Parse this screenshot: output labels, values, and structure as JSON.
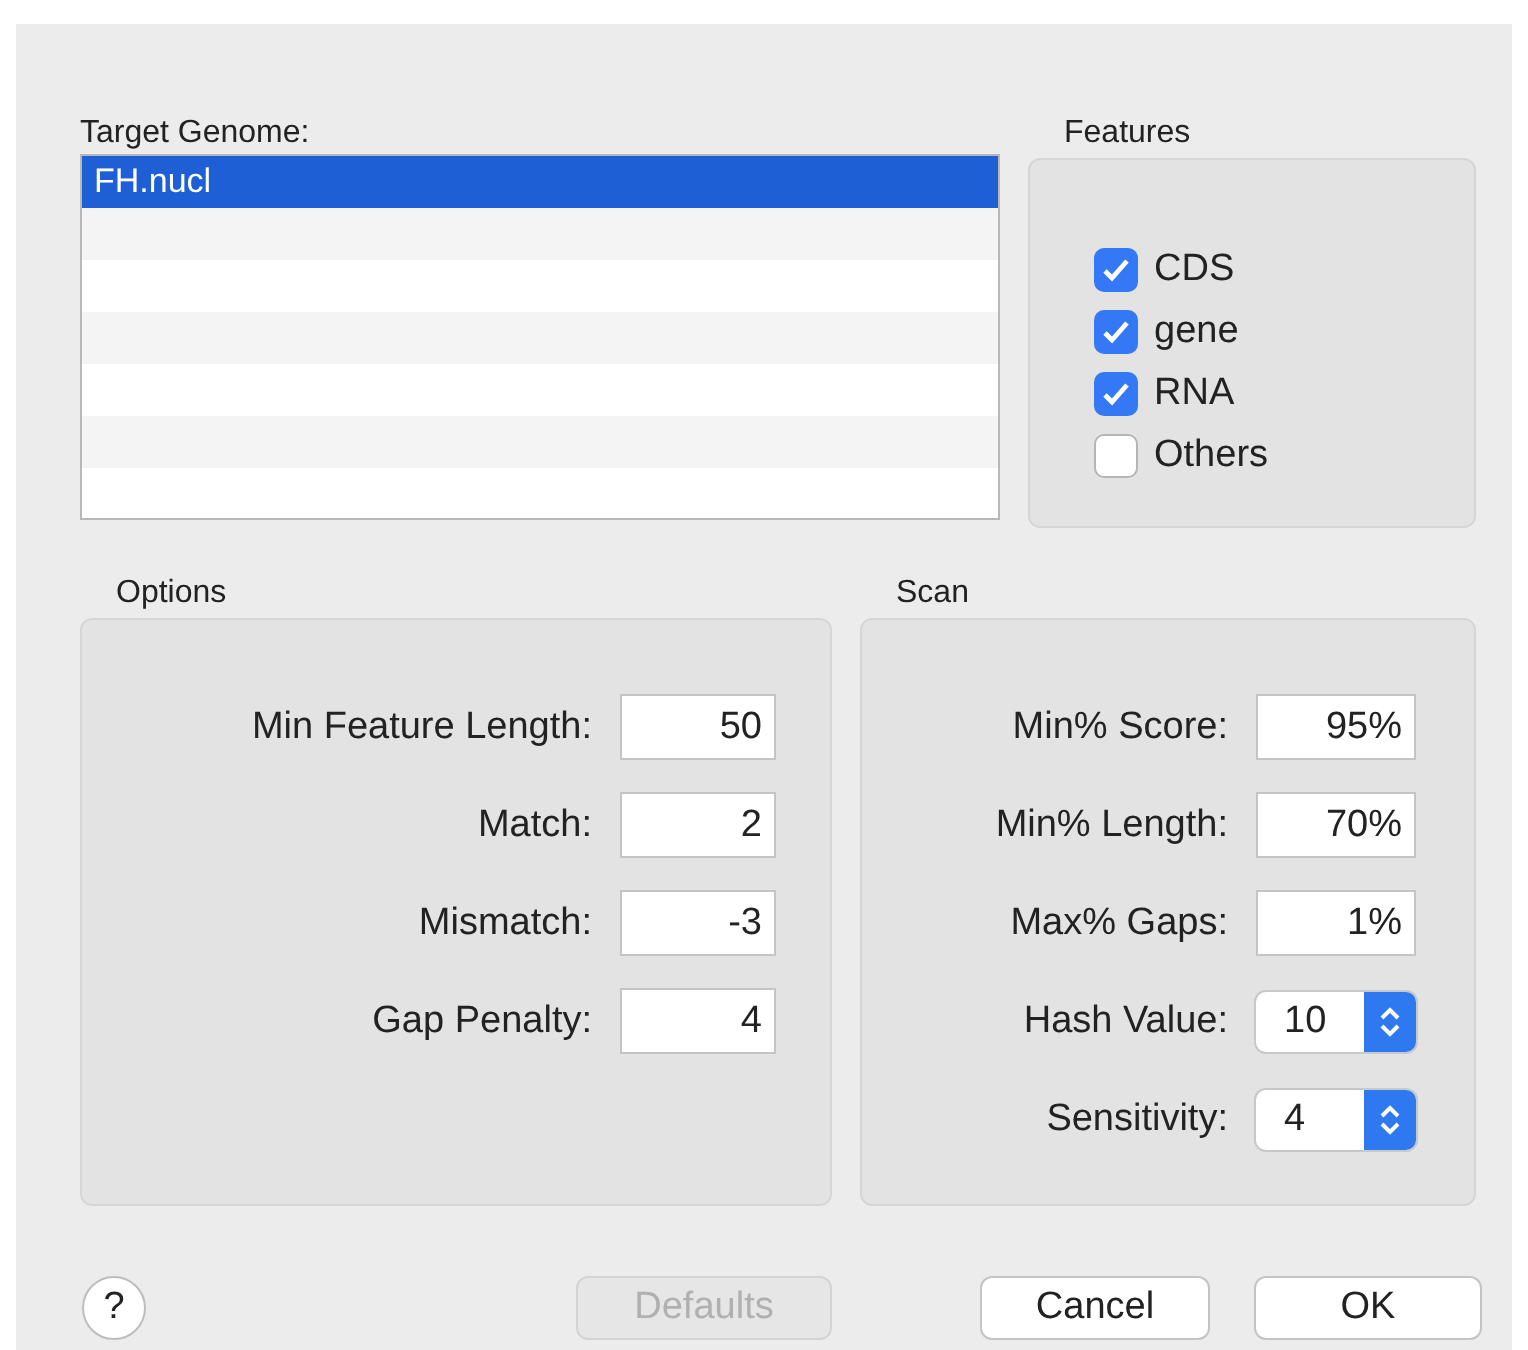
{
  "target_genome": {
    "label": "Target Genome:",
    "items": [
      {
        "name": "FH.nucl",
        "selected": true
      }
    ]
  },
  "features": {
    "title": "Features",
    "items": [
      {
        "label": "CDS",
        "checked": true
      },
      {
        "label": "gene",
        "checked": true
      },
      {
        "label": "RNA",
        "checked": true
      },
      {
        "label": "Others",
        "checked": false
      }
    ]
  },
  "options": {
    "title": "Options",
    "fields": [
      {
        "kind": "text",
        "label": "Min Feature Length:",
        "value": "50"
      },
      {
        "kind": "text",
        "label": "Match:",
        "value": "2"
      },
      {
        "kind": "text",
        "label": "Mismatch:",
        "value": "-3"
      },
      {
        "kind": "text",
        "label": "Gap Penalty:",
        "value": "4"
      }
    ]
  },
  "scan": {
    "title": "Scan",
    "fields": [
      {
        "kind": "text",
        "label": "Min% Score:",
        "value": "95%"
      },
      {
        "kind": "text",
        "label": "Min% Length:",
        "value": "70%"
      },
      {
        "kind": "text",
        "label": "Max% Gaps:",
        "value": "1%"
      },
      {
        "kind": "popup",
        "label": "Hash Value:",
        "value": "10"
      },
      {
        "kind": "popup",
        "label": "Sensitivity:",
        "value": "4"
      }
    ]
  },
  "buttons": [
    {
      "kind": "help",
      "label": "?"
    },
    {
      "kind": "push",
      "label": "Defaults",
      "disabled": true
    },
    {
      "kind": "push",
      "label": "Cancel",
      "disabled": false
    },
    {
      "kind": "push",
      "label": "OK",
      "disabled": false
    }
  ]
}
